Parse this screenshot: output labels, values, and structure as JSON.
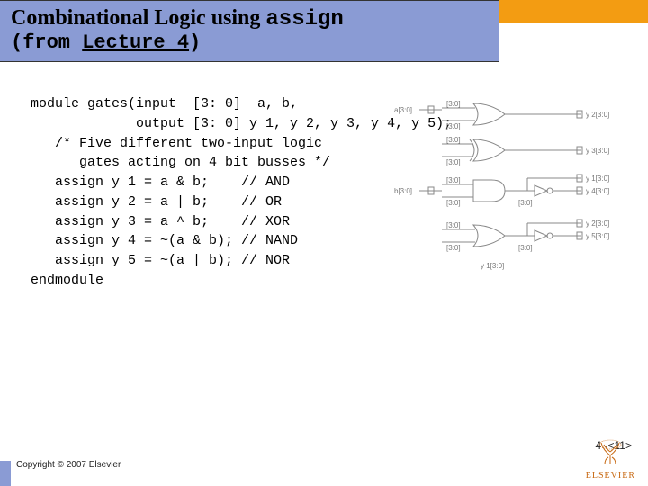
{
  "header": {
    "title_prefix": "Combinational Logic using ",
    "title_mono": "assign",
    "subtitle_open": "(from ",
    "subtitle_link": "Lecture 4",
    "subtitle_close": ")"
  },
  "code": {
    "l1": "module gates(input  [3: 0]  a, b,",
    "l2": "             output [3: 0] y 1, y 2, y 3, y 4, y 5);",
    "l3": "   /* Five different two-input logic",
    "l4": "      gates acting on 4 bit busses */",
    "l5": "   assign y 1 = a & b;    // AND",
    "l6": "   assign y 2 = a | b;    // OR",
    "l7": "   assign y 3 = a ^ b;    // XOR",
    "l8": "   assign y 4 = ~(a & b); // NAND",
    "l9": "   assign y 5 = ~(a | b); // NOR",
    "l10": "endmodule"
  },
  "diagram": {
    "inputs": {
      "a": "a[3:0]",
      "b": "b[3:0]"
    },
    "bus": "[3:0]",
    "gates": [
      {
        "name": "OR",
        "output": "y 2[3:0]"
      },
      {
        "name": "XOR",
        "output": "y 3[3:0]"
      },
      {
        "name": "AND",
        "output_a": "y 1[3:0]",
        "output_b": "y 4[3:0]",
        "inv_b": true
      },
      {
        "name": "OR2",
        "output_a": "y 2[3:0]",
        "output_b": "y 5[3:0]",
        "inv_b": true
      }
    ],
    "extra_labels": [
      "y 1[3:0]"
    ]
  },
  "footer": {
    "copyright": "Copyright © 2007 Elsevier",
    "pagenum": "4 -<11>",
    "logo_name": "ELSEVIER"
  }
}
